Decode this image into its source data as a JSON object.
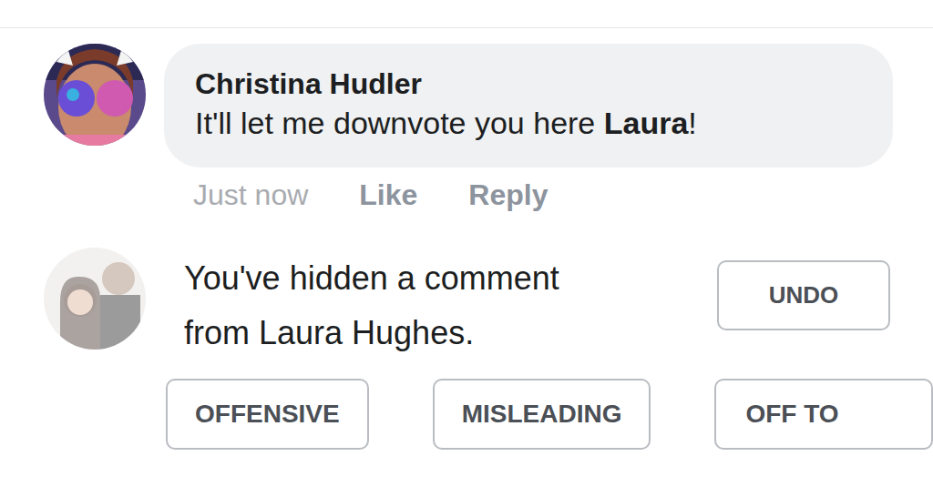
{
  "comment": {
    "author": "Christina Hudler",
    "text": [
      "It'll let me downvote you here ",
      "Laura",
      "!"
    ],
    "time": "Just now",
    "like": "Like",
    "reply": "Reply"
  },
  "hidden": {
    "message": "You've hidden a comment from Laura Hughes.",
    "undo": "UNDO"
  },
  "feedback": [
    "OFFENSIVE",
    "MISLEADING",
    "OFF TO"
  ]
}
